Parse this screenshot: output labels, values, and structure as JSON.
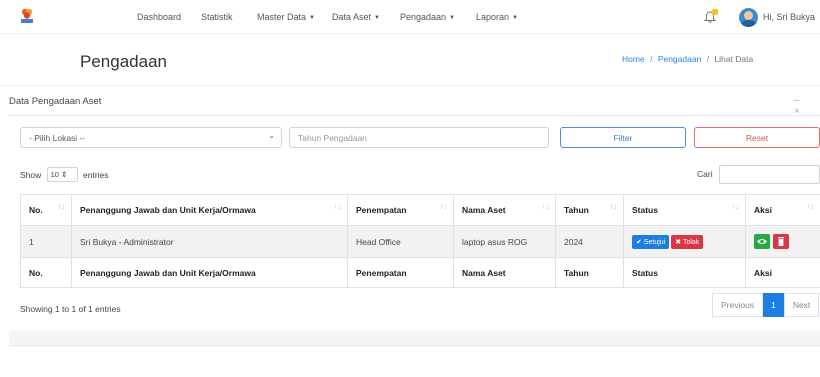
{
  "nav": {
    "items": [
      {
        "label": "Dashboard",
        "dropdown": false
      },
      {
        "label": "Statistik",
        "dropdown": false
      },
      {
        "label": "Master Data",
        "dropdown": true
      },
      {
        "label": "Data Aset",
        "dropdown": true
      },
      {
        "label": "Pengadaan",
        "dropdown": true
      },
      {
        "label": "Laporan",
        "dropdown": true
      }
    ],
    "user_greeting": "Hi, Sri Bukya",
    "notification_icon": "bell-icon",
    "logo_icon": "logo-icon"
  },
  "page": {
    "title": "Pengadaan",
    "breadcrumb": {
      "home": "Home",
      "section": "Pengadaan",
      "current": "Lihat Data",
      "separator": "/"
    }
  },
  "card": {
    "title": "Data Pengadaan Aset",
    "collapse_label": "–",
    "close_label": "×"
  },
  "filters": {
    "location_value": "- Pilih Lokasi --",
    "year_placeholder": "Tahun Pengadaan",
    "filter_label": "Filter",
    "reset_label": "Reset"
  },
  "length": {
    "show_label": "Show",
    "value": "10",
    "entries_label": "entries"
  },
  "search": {
    "label": "Cari"
  },
  "table": {
    "columns": [
      "No.",
      "Penanggung Jawab dan Unit Kerja/Ormawa",
      "Penempatan",
      "Nama Aset",
      "Tahun",
      "Status",
      "Aksi"
    ],
    "rows": [
      {
        "no": "1",
        "pj": "Sri Bukya - Administrator",
        "penempatan": "Head Office",
        "nama_aset": "laptop asus ROG",
        "tahun": "2024",
        "setuju_label": "Setujui",
        "tolak_label": "Tolak"
      }
    ]
  },
  "info": "Showing 1 to 1 of 1 entries",
  "pagination": {
    "previous": "Previous",
    "current": "1",
    "next": "Next"
  },
  "colors": {
    "primary": "#1e7fe0",
    "danger": "#dc3545",
    "success": "#28a745",
    "accent_logo": "#e8612c"
  }
}
